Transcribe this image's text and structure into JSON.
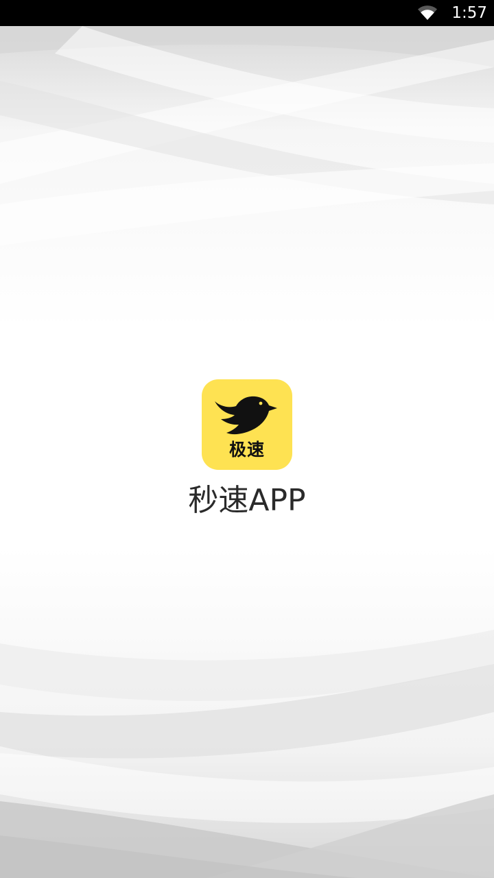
{
  "status_bar": {
    "time": "1:57",
    "wifi_icon": "wifi-icon"
  },
  "splash": {
    "icon": {
      "name": "bird-icon",
      "label": "极速",
      "background_color": "#FEE252"
    },
    "app_name": "秒速APP"
  },
  "colors": {
    "status_bar": "#000000",
    "background": "#ffffff",
    "icon_yellow": "#FEE252"
  }
}
